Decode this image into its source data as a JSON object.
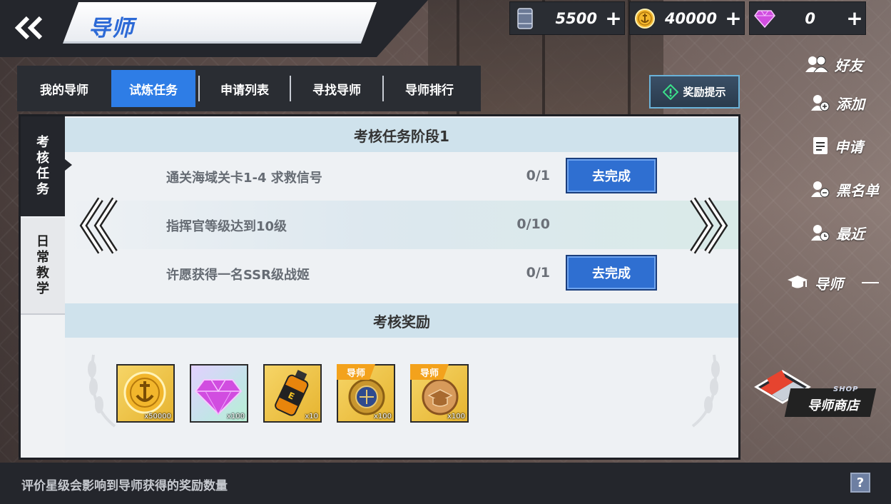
{
  "header": {
    "title": "导师",
    "back_icon": "double-chevron-left-icon"
  },
  "currencies": [
    {
      "icon": "fuel-barrel-icon",
      "amount": "5500"
    },
    {
      "icon": "gold-anchor-coin-icon",
      "amount": "40000"
    },
    {
      "icon": "purple-diamond-icon",
      "amount": "0"
    }
  ],
  "currency_add_label": "+",
  "tabs": [
    {
      "label": "我的导师",
      "active": false
    },
    {
      "label": "试炼任务",
      "active": true
    },
    {
      "label": "申请列表",
      "active": false
    },
    {
      "label": "寻找导师",
      "active": false
    },
    {
      "label": "导师排行",
      "active": false
    }
  ],
  "reward_hint_button": "奖励提示",
  "side_tabs": [
    {
      "label": "考核任务",
      "chars": [
        "考",
        "核",
        "任",
        "务"
      ],
      "active": true
    },
    {
      "label": "日常教学",
      "chars": [
        "日",
        "常",
        "教",
        "学"
      ],
      "active": false
    }
  ],
  "task_section_title": "考核任务阶段1",
  "tasks": [
    {
      "name": "通关海域关卡1-4 求救信号",
      "progress": "0/1",
      "action": "去完成"
    },
    {
      "name": "指挥官等级达到10级",
      "progress": "0/10",
      "action": ""
    },
    {
      "name": "许愿获得一名SSR级战姬",
      "progress": "0/1",
      "action": "去完成"
    }
  ],
  "reward_section_title": "考核奖励",
  "rewards": [
    {
      "icon": "gold-anchor-coin-icon",
      "qty": "x50000",
      "tag": ""
    },
    {
      "icon": "purple-diamond-icon",
      "qty": "x100",
      "tag": ""
    },
    {
      "icon": "fuel-bottle-icon",
      "qty": "x10",
      "tag": ""
    },
    {
      "icon": "mentor-badge-icon",
      "qty": "x100",
      "tag": "导师"
    },
    {
      "icon": "mentor-medal-icon",
      "qty": "x100",
      "tag": "导师"
    }
  ],
  "right_menu": [
    {
      "label": "好友",
      "icon": "friends-icon"
    },
    {
      "label": "添加",
      "icon": "add-friend-icon"
    },
    {
      "label": "申请",
      "icon": "application-icon"
    },
    {
      "label": "黑名单",
      "icon": "blacklist-icon"
    },
    {
      "label": "最近",
      "icon": "recent-icon"
    },
    {
      "label": "导师",
      "icon": "graduation-cap-icon"
    }
  ],
  "shop": {
    "label": "导师商店",
    "label_en": "SHOP"
  },
  "footer": {
    "text": "评价星级会影响到导师获得的奖励数量",
    "help_label": "?"
  },
  "colors": {
    "accent_blue": "#2e7de6",
    "dark_bar": "#24262c",
    "header_band": "#cfe2ec",
    "tag_orange": "#f3a21c"
  }
}
